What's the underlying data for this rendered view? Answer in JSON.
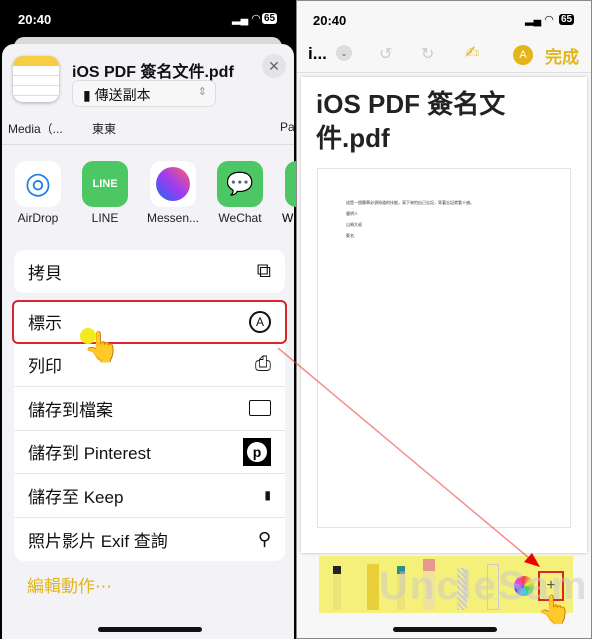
{
  "status": {
    "time": "20:40",
    "battery": "65"
  },
  "share": {
    "title": "iOS PDF 簽名文件.pdf",
    "send_option": "傳送副本",
    "contacts": [
      "Media（...",
      "東東",
      "Pa"
    ],
    "apps": [
      {
        "label": "AirDrop",
        "icon": "airdrop-icon"
      },
      {
        "label": "LINE",
        "icon": "line-icon"
      },
      {
        "label": "Messen...",
        "icon": "messenger-icon"
      },
      {
        "label": "WeChat",
        "icon": "wechat-icon"
      },
      {
        "label": "Wh",
        "icon": "whatsapp-icon"
      }
    ],
    "copy": "拷貝",
    "markup": "標示",
    "actions": [
      {
        "label": "列印",
        "icon": "printer-icon"
      },
      {
        "label": "儲存到檔案",
        "icon": "folder-icon"
      },
      {
        "label": "儲存到 Pinterest",
        "icon": "pinterest-icon"
      },
      {
        "label": "儲存至 Keep",
        "icon": "bookmark-icon"
      },
      {
        "label": "照片影片 Exif 查詢",
        "icon": "location-pin-icon"
      }
    ],
    "edit_actions": "編輯動作⋯"
  },
  "markup_view": {
    "short_title": "i...",
    "done": "完成",
    "doc_title_line1": "iOS PDF 簽名文",
    "doc_title_line2": "件.pdf",
    "pdf_lines": [
      "這是一個簡單必須知道的技能，寫下來怕自己忘記，背著忘記就看十遍。",
      "聲明人",
      "山姆大叔",
      "簽名:"
    ],
    "tools": [
      "pen",
      "marker",
      "pencil",
      "eraser",
      "lasso",
      "ruler"
    ],
    "watermark": "UncleSam"
  },
  "colors": {
    "accent": "#e3b51b",
    "highlight_red": "#d9262c",
    "toolbar_highlight": "#f5f07a"
  }
}
